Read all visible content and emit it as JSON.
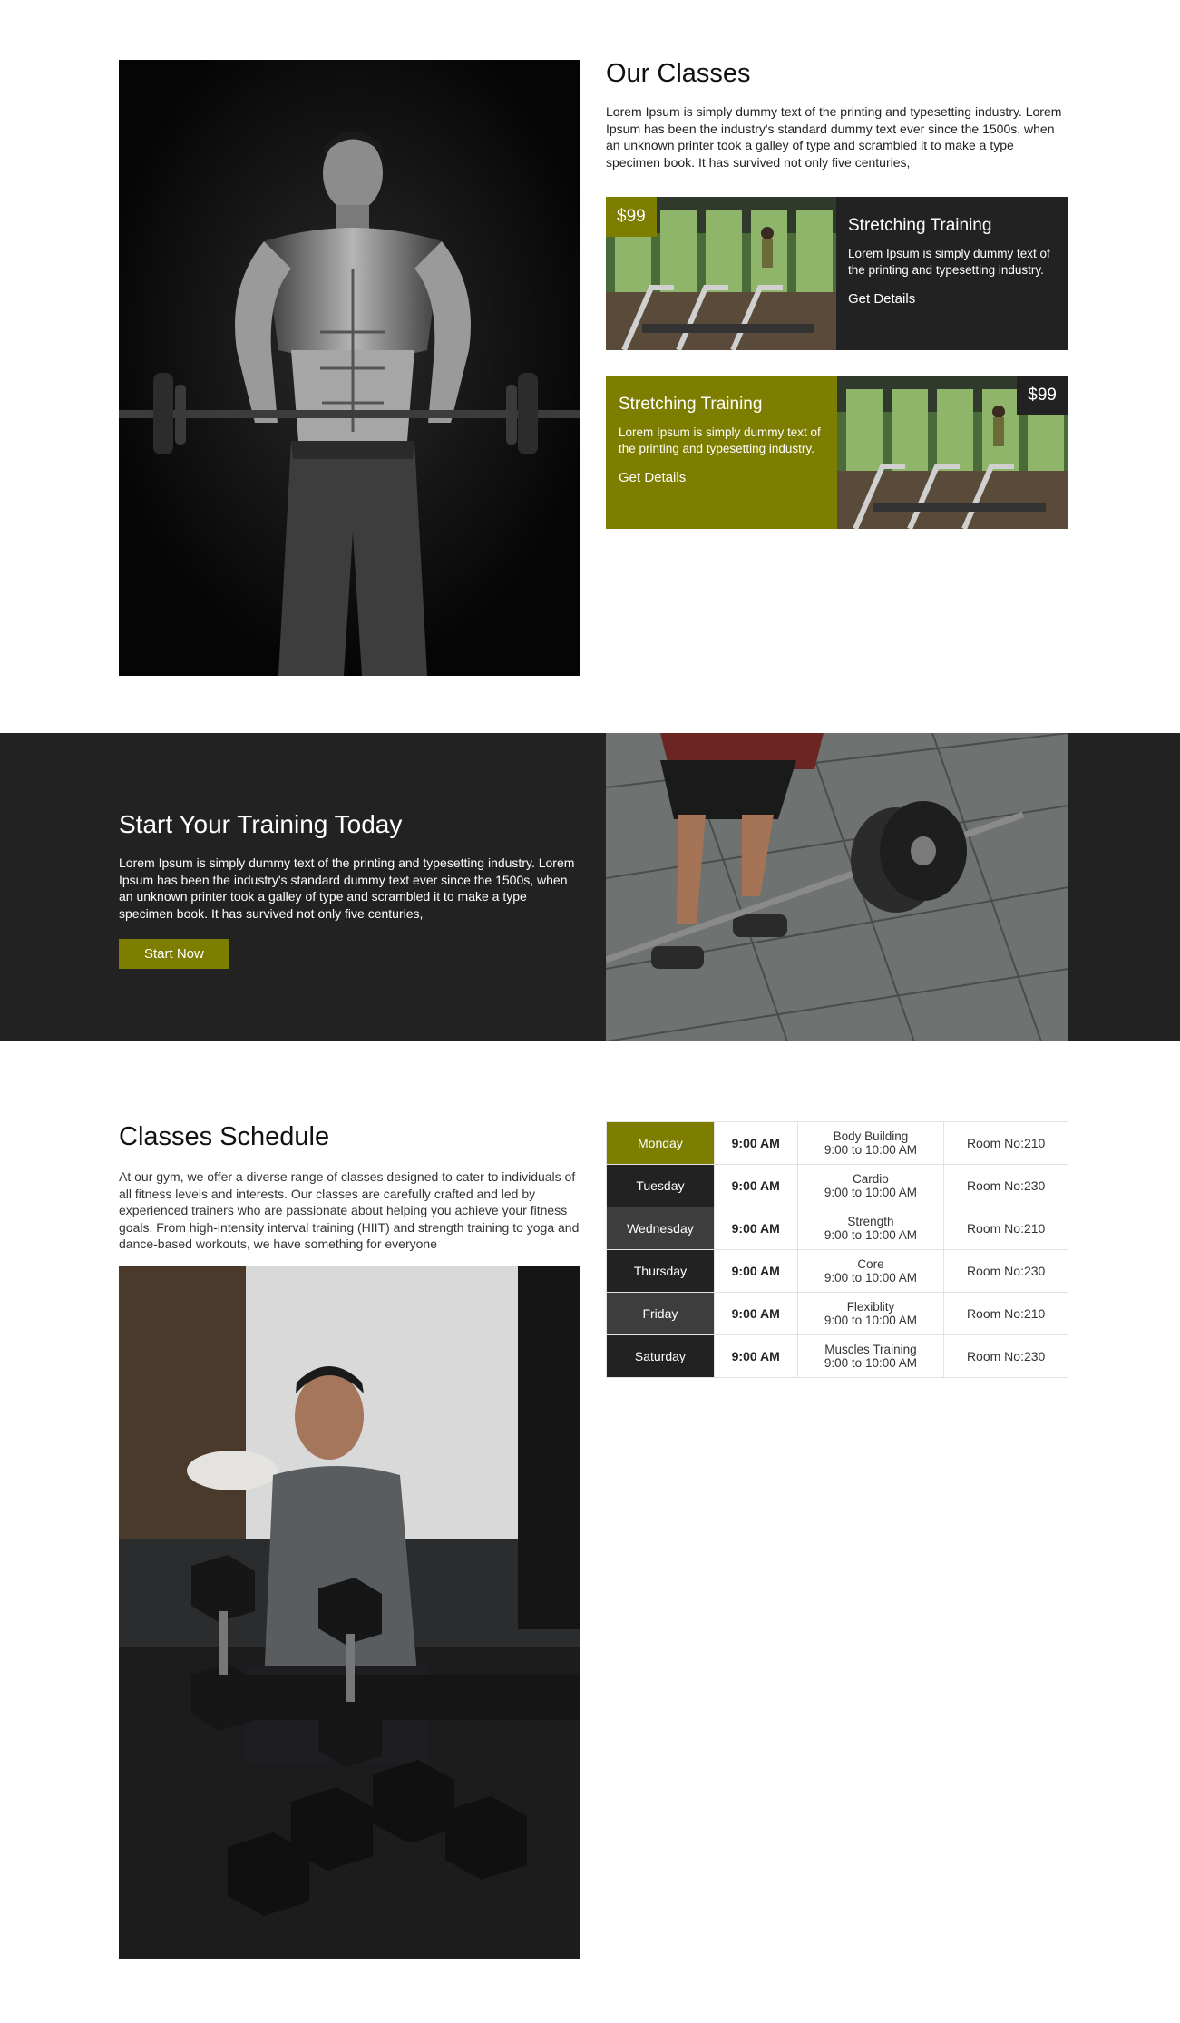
{
  "classes_section": {
    "title": "Our Classes",
    "intro": "Lorem Ipsum is simply dummy text of the printing and typesetting industry. Lorem Ipsum has been the industry's standard dummy text ever since the 1500s, when an unknown printer took a galley of type and scrambled it to make a type specimen book. It has survived not only five centuries,",
    "cards": [
      {
        "price": "$99",
        "title": "Stretching Training",
        "description": "Lorem Ipsum is simply dummy text of the printing and typesetting industry.",
        "link": "Get Details"
      },
      {
        "price": "$99",
        "title": "Stretching Training",
        "description": "Lorem Ipsum is simply dummy text of the printing and typesetting industry.",
        "link": "Get Details"
      }
    ]
  },
  "training_section": {
    "title": "Start Your Training Today",
    "text": "Lorem Ipsum is simply dummy text of the printing and typesetting industry. Lorem Ipsum has been the industry's standard dummy text ever since the 1500s, when an unknown printer took a galley of type and scrambled it to make a type specimen book. It has survived not only five centuries,",
    "button": "Start Now"
  },
  "schedule_section": {
    "title": "Classes Schedule",
    "text": "At our gym, we offer a diverse range of classes designed to cater to individuals of all fitness levels and interests. Our classes are carefully crafted and led by experienced trainers who are passionate about helping you achieve your fitness goals. From high-intensity interval training (HIIT) and strength training to yoga and dance-based workouts, we have something for everyone",
    "rows": [
      {
        "day": "Monday",
        "time": "9:00 AM",
        "class": "Body Building",
        "hours": "9:00 to 10:00 AM",
        "room": "Room No:210"
      },
      {
        "day": "Tuesday",
        "time": "9:00 AM",
        "class": "Cardio",
        "hours": "9:00 to 10:00 AM",
        "room": "Room No:230"
      },
      {
        "day": "Wednesday",
        "time": "9:00 AM",
        "class": "Strength",
        "hours": "9:00 to 10:00 AM",
        "room": "Room No:210"
      },
      {
        "day": "Thursday",
        "time": "9:00 AM",
        "class": "Core",
        "hours": "9:00 to 10:00 AM",
        "room": "Room No:230"
      },
      {
        "day": "Friday",
        "time": "9:00 AM",
        "class": "Flexiblity",
        "hours": "9:00 to 10:00 AM",
        "room": "Room No:210"
      },
      {
        "day": "Saturday",
        "time": "9:00 AM",
        "class": "Muscles Training",
        "hours": "9:00 to 10:00 AM",
        "room": "Room No:230"
      }
    ]
  },
  "colors": {
    "accent": "#7d7d00",
    "dark": "#222222",
    "grey": "#3d3d3d"
  }
}
